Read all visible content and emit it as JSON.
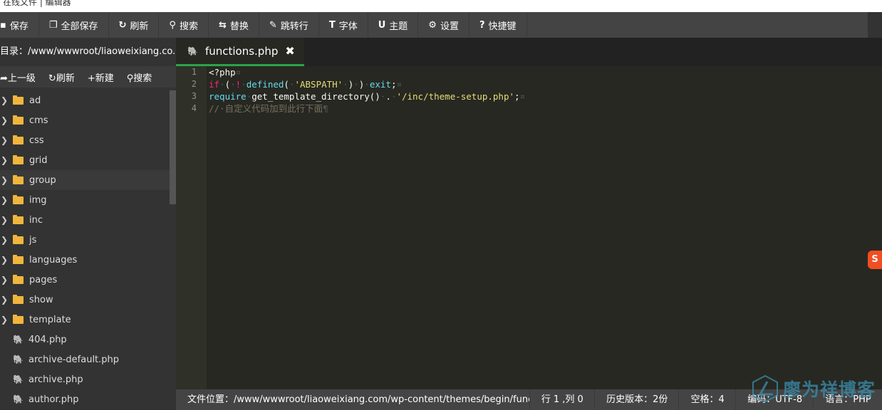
{
  "window": {
    "title": "在线文件 | 编辑器"
  },
  "toolbar": [
    {
      "icon": "save-icon",
      "glyph": "▪",
      "label": "保存"
    },
    {
      "icon": "save-all-icon",
      "glyph": "❐",
      "label": "全部保存"
    },
    {
      "icon": "refresh-icon",
      "glyph": "↻",
      "label": "刷新"
    },
    {
      "icon": "search-icon",
      "glyph": "⚲",
      "label": "搜索"
    },
    {
      "icon": "replace-icon",
      "glyph": "⇆",
      "label": "替换"
    },
    {
      "icon": "pin-icon",
      "glyph": "✎",
      "label": "跳转行"
    },
    {
      "icon": "font-icon",
      "glyph": "T",
      "label": "字体"
    },
    {
      "icon": "magnet-icon",
      "glyph": "U",
      "label": "主题"
    },
    {
      "icon": "gear-icon",
      "glyph": "⚙",
      "label": "设置"
    },
    {
      "icon": "question-icon",
      "glyph": "?",
      "label": "快捷键"
    }
  ],
  "sidebar": {
    "directory": "目录：/www/wwwroot/liaoweixiang.co...",
    "actions": [
      {
        "glyph": "➦",
        "label": "上一级"
      },
      {
        "glyph": "↻",
        "label": "刷新"
      },
      {
        "glyph": "+",
        "label": "新建"
      },
      {
        "glyph": "⚲",
        "label": "搜索"
      }
    ],
    "folders": [
      "ad",
      "cms",
      "css",
      "grid",
      "group",
      "img",
      "inc",
      "js",
      "languages",
      "pages",
      "show",
      "template"
    ],
    "files": [
      "404.php",
      "archive-default.php",
      "archive.php",
      "author.php"
    ]
  },
  "editor": {
    "tab": {
      "label": "functions.php",
      "close": "✖"
    },
    "line_numbers": [
      "1",
      "2",
      "3",
      "4"
    ]
  },
  "status": {
    "path": "文件位置：/www/wwwroot/liaoweixiang.com/wp-content/themes/begin/functions.php",
    "cursor": "行 1 ,列 0",
    "history": "历史版本：2份",
    "indent": "空格：4",
    "encoding": "编码：UTF-8",
    "language": "语言：PHP"
  },
  "watermark": {
    "text": "廖为祥博客"
  },
  "colors": {
    "accent": "#2ca24a",
    "folder": "#f0b63c",
    "keyword": "#f92672",
    "function": "#66d9ef",
    "string": "#e6db74",
    "comment": "#75715e"
  }
}
